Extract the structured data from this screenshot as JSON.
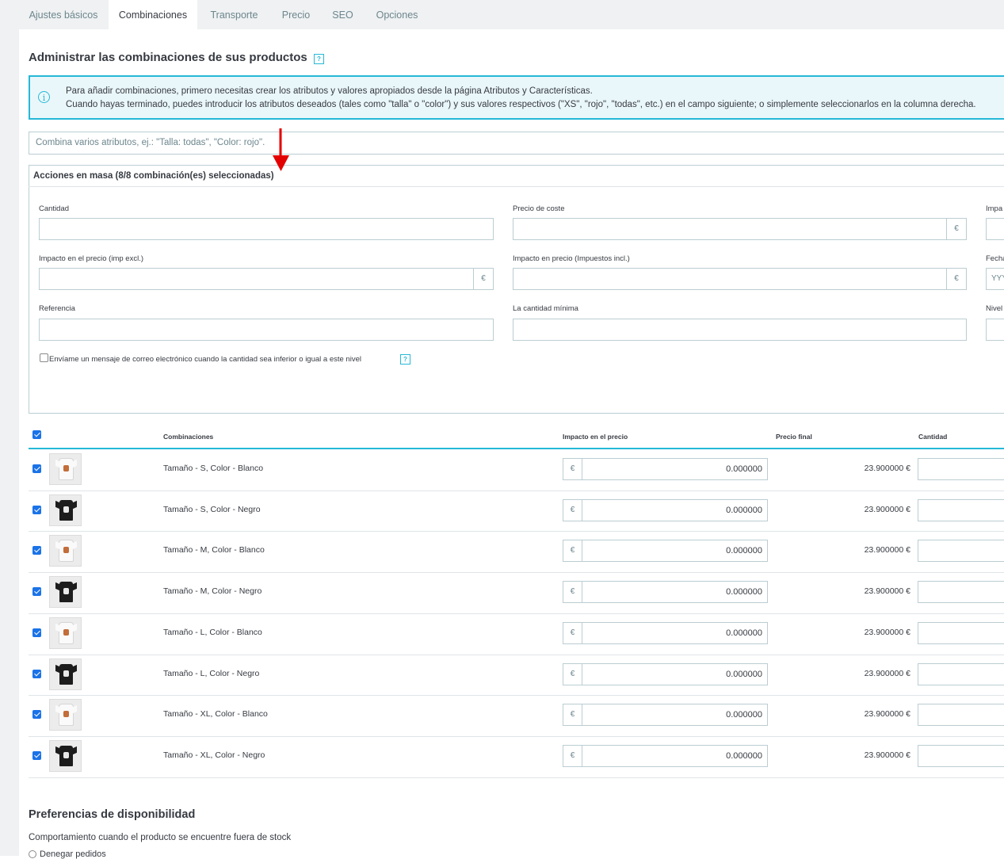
{
  "tabs": [
    {
      "label": "Ajustes básicos",
      "active": false
    },
    {
      "label": "Combinaciones",
      "active": true
    },
    {
      "label": "Transporte",
      "active": false
    },
    {
      "label": "Precio",
      "active": false
    },
    {
      "label": "SEO",
      "active": false
    },
    {
      "label": "Opciones",
      "active": false
    }
  ],
  "section": {
    "title": "Administrar las combinaciones de sus productos",
    "help_icon": "?"
  },
  "alert": {
    "icon": "info-icon",
    "line1": "Para añadir combinaciones, primero necesitas crear los atributos y valores apropiados desde la página Atributos y Características.",
    "line2": "Cuando hayas terminado, puedes introducir los atributos deseados (tales como \"talla\" o \"color\") y sus valores respectivos (\"XS\", \"rojo\", \"todas\", etc.) en el campo siguiente; o simplemente seleccionarlos en la columna derecha."
  },
  "combine_input": {
    "placeholder": "Combina varios atributos, ej.: \"Talla: todas\", \"Color: rojo\"."
  },
  "bulk": {
    "title": "Acciones en masa (8/8 combinación(es) seleccionadas)",
    "fields": {
      "quantity": "Cantidad",
      "cost_price": "Precio de coste",
      "impact_partial": "Impa",
      "price_impact_excl": "Impacto en el precio (imp excl.)",
      "price_impact_incl": "Impacto en precio (Impuestos incl.)",
      "date_partial": "Fecha",
      "date_placeholder": "YYY",
      "reference": "Referencia",
      "min_qty": "La cantidad mínima",
      "level_partial": "Nivel"
    },
    "currency": "€",
    "notify_label": "Envíame un mensaje de correo electrónico cuando la cantidad sea inferior o igual a este nivel"
  },
  "table": {
    "headers": {
      "combinations": "Combinaciones",
      "price_impact": "Impacto en el precio",
      "final_price": "Precio final",
      "quantity": "Cantidad"
    },
    "currency": "€",
    "rows": [
      {
        "name": "Tamaño - S, Color - Blanco",
        "impact": "0.000000",
        "final": "23.900000 €",
        "shirt": "white"
      },
      {
        "name": "Tamaño - S, Color - Negro",
        "impact": "0.000000",
        "final": "23.900000 €",
        "shirt": "black"
      },
      {
        "name": "Tamaño - M, Color - Blanco",
        "impact": "0.000000",
        "final": "23.900000 €",
        "shirt": "white"
      },
      {
        "name": "Tamaño - M, Color - Negro",
        "impact": "0.000000",
        "final": "23.900000 €",
        "shirt": "black"
      },
      {
        "name": "Tamaño - L, Color - Blanco",
        "impact": "0.000000",
        "final": "23.900000 €",
        "shirt": "white"
      },
      {
        "name": "Tamaño - L, Color - Negro",
        "impact": "0.000000",
        "final": "23.900000 €",
        "shirt": "black"
      },
      {
        "name": "Tamaño - XL, Color - Blanco",
        "impact": "0.000000",
        "final": "23.900000 €",
        "shirt": "white"
      },
      {
        "name": "Tamaño - XL, Color - Negro",
        "impact": "0.000000",
        "final": "23.900000 €",
        "shirt": "black"
      }
    ]
  },
  "availability": {
    "title": "Preferencias de disponibilidad",
    "subtitle": "Comportamiento cuando el producto se encuentre fuera de stock",
    "option1": "Denegar pedidos"
  },
  "colors": {
    "accent": "#25b9d7",
    "arrow": "#e30000",
    "checkbox": "#1a73e8"
  }
}
